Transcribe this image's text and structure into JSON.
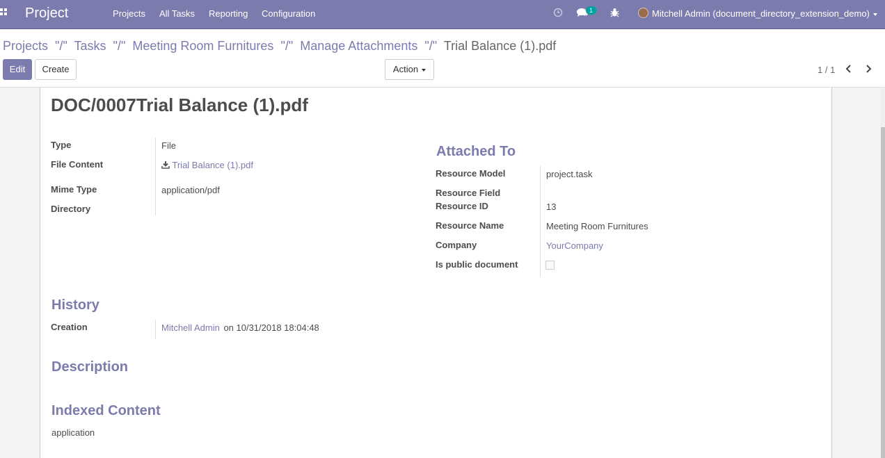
{
  "navbar": {
    "app_name": "Project",
    "menu": [
      "Projects",
      "All Tasks",
      "Reporting",
      "Configuration"
    ],
    "message_count": "1",
    "user_name": "Mitchell Admin (document_directory_extension_demo)"
  },
  "breadcrumb": {
    "items": [
      "Projects",
      "Tasks",
      "Meeting Room Furnitures",
      "Manage Attachments"
    ],
    "separator": "\"/\"",
    "current": "Trial Balance (1).pdf"
  },
  "toolbar": {
    "edit_label": "Edit",
    "create_label": "Create",
    "action_label": "Action"
  },
  "pager": {
    "value": "1 / 1"
  },
  "record": {
    "title": "DOC/0007Trial Balance (1).pdf",
    "left": {
      "type_label": "Type",
      "type_value": "File",
      "file_content_label": "File Content",
      "file_content_value": "Trial Balance (1).pdf",
      "mime_type_label": "Mime Type",
      "mime_type_value": "application/pdf",
      "directory_label": "Directory"
    },
    "attached_to": {
      "title": "Attached To",
      "resource_model_label": "Resource Model",
      "resource_model_value": "project.task",
      "resource_field_label": "Resource Field",
      "resource_id_label": "Resource ID",
      "resource_id_value": "13",
      "resource_name_label": "Resource Name",
      "resource_name_value": "Meeting Room Furnitures",
      "company_label": "Company",
      "company_value": "YourCompany",
      "public_label": "Is public document",
      "public_value": false
    },
    "history": {
      "title": "History",
      "creation_label": "Creation",
      "creator": "Mitchell Admin",
      "created_on": "on 10/31/2018 18:04:48"
    },
    "description": {
      "title": "Description"
    },
    "indexed_content": {
      "title": "Indexed Content",
      "value": "application"
    }
  },
  "colors": {
    "brand": "#7c7bad",
    "badge": "#00a09d"
  },
  "icons": [
    "apps-icon",
    "clock-icon",
    "chat-icon",
    "bug-icon",
    "download-icon",
    "chevron-left-icon",
    "chevron-right-icon"
  ]
}
